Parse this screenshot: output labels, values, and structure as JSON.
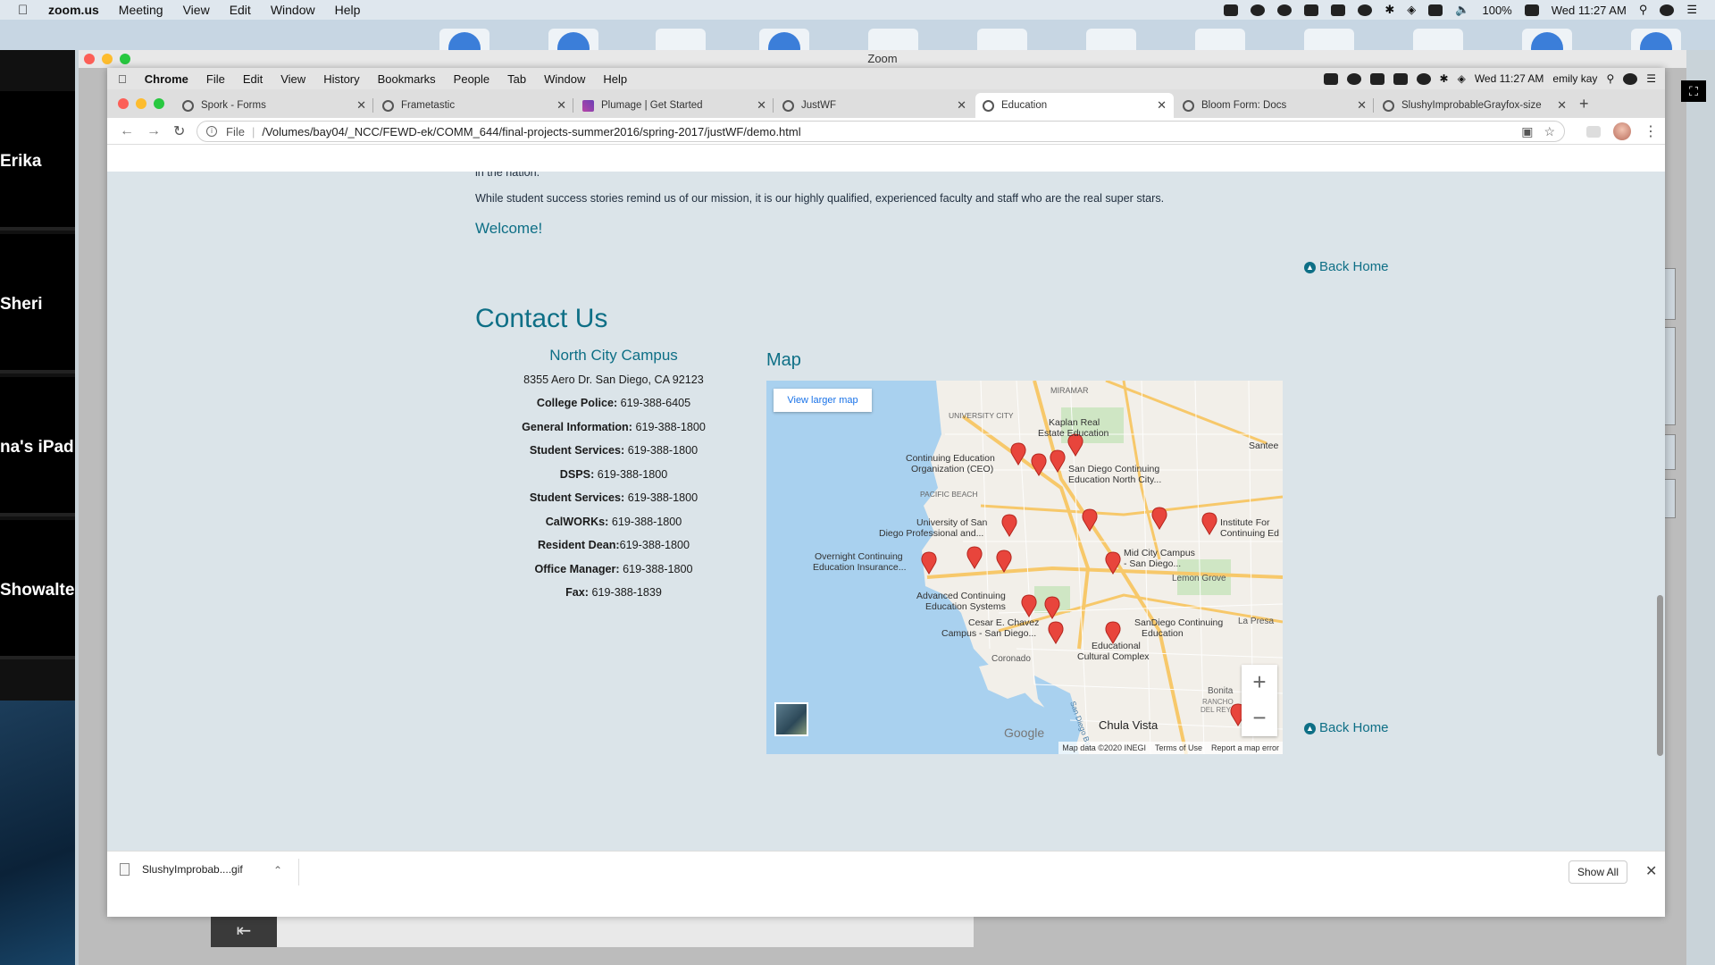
{
  "os_menubar": {
    "app": "zoom.us",
    "items": [
      "Meeting",
      "View",
      "Edit",
      "Window",
      "Help"
    ],
    "battery": "100%",
    "clock": "Wed 11:27 AM"
  },
  "zoom_window": {
    "title": "Zoom",
    "participants": [
      "Erika",
      "Sheri",
      "na's iPad",
      "Showalte"
    ],
    "back_arrow": "⇤"
  },
  "chrome_menubar": {
    "app": "Chrome",
    "items": [
      "File",
      "Edit",
      "View",
      "History",
      "Bookmarks",
      "People",
      "Tab",
      "Window",
      "Help"
    ],
    "clock": "Wed 11:27 AM",
    "user": "emily kay"
  },
  "tabs": [
    {
      "title": "Spork - Forms"
    },
    {
      "title": "Frametastic"
    },
    {
      "title": "Plumage | Get Started"
    },
    {
      "title": "JustWF"
    },
    {
      "title": "Education"
    },
    {
      "title": "Bloom Form: Docs"
    },
    {
      "title": "SlushyImprobableGrayfox-size"
    }
  ],
  "address_bar": {
    "scheme": "File",
    "url": "/Volumes/bay04/_NCC/FEWD-ek/COMM_644/final-projects-summer2016/spring-2017/justWF/demo.html"
  },
  "page": {
    "text_top": "in the nation.",
    "text_mission": "While student success stories remind us of our mission, it is our highly qualified, experienced faculty and staff who are the real super stars.",
    "welcome": "Welcome!",
    "back_home": "Back Home",
    "contact_heading": "Contact Us",
    "campus": "North City Campus",
    "address": "8355 Aero Dr. San Diego, CA 92123",
    "contacts": [
      {
        "label": "College Police:",
        "value": " 619-388-6405"
      },
      {
        "label": "General Information:",
        "value": " 619-388-1800"
      },
      {
        "label": "Student Services:",
        "value": " 619-388-1800"
      },
      {
        "label": "DSPS:",
        "value": " 619-388-1800"
      },
      {
        "label": "Student Services:",
        "value": " 619-388-1800"
      },
      {
        "label": "CalWORKs:",
        "value": " 619-388-1800"
      },
      {
        "label": "Resident Dean:",
        "value": "619-388-1800"
      },
      {
        "label": "Office Manager:",
        "value": " 619-388-1800"
      },
      {
        "label": "Fax:",
        "value": " 619-388-1839"
      }
    ],
    "map_heading": "Map"
  },
  "map": {
    "view_larger": "View larger map",
    "google": "Google",
    "attribution": [
      "Map data ©2020 INEGI",
      "Terms of Use",
      "Report a map error"
    ],
    "zoom_in": "+",
    "zoom_out": "−",
    "labels": [
      "MIRAMAR",
      "UNIVERSITY CITY",
      "Kaplan Real",
      "Estate Education",
      "Santee",
      "Continuing Education",
      "Organization (CEO)",
      "San Diego Continuing",
      "Education North City...",
      "PACIFIC BEACH",
      "University of San",
      "Diego Professional and...",
      "Institute For",
      "Continuing Ed",
      "Overnight Continuing",
      "Education Insurance...",
      "Mid City Campus",
      "- San Diego...",
      "Lemon Grove",
      "Advanced Continuing",
      "Education Systems",
      "Cesar E. Chavez",
      "Campus - San Diego...",
      "SanDiego Continuing",
      "Education",
      "La Presa",
      "Educational",
      "Cultural Complex",
      "Coronado",
      "Bonita",
      "RANCHO",
      "DEL REY",
      "Chula Vista",
      "San Diego Bay"
    ],
    "colors": {
      "water": "#a9d1ef",
      "land": "#f2efe9",
      "highway": "#f7c86a",
      "pin": "#e8453c"
    }
  },
  "download_bar": {
    "file": "SlushyImprobab....gif",
    "show_all": "Show All"
  }
}
